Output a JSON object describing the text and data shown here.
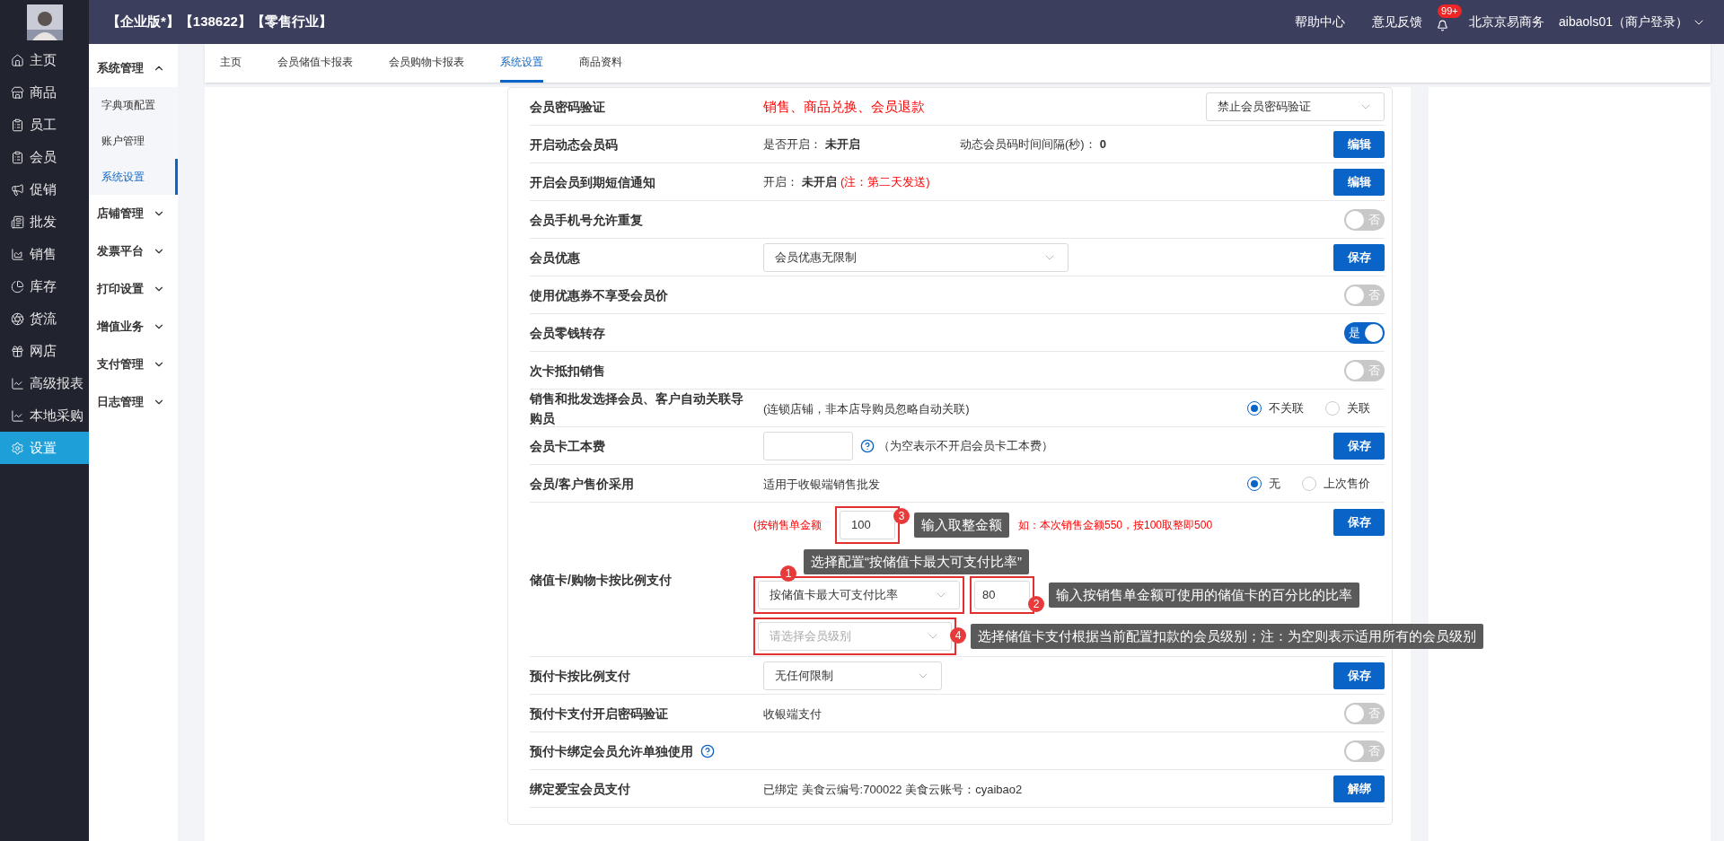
{
  "header": {
    "title": "【企业版*】【138622】【零售行业】",
    "links": [
      "帮助中心",
      "意见反馈"
    ],
    "notification_badge": "99+",
    "company": "北京京易商务",
    "user": "aibaols01（商户登录）"
  },
  "nav": [
    {
      "label": "主页",
      "selected": false
    },
    {
      "label": "商品",
      "selected": false
    },
    {
      "label": "员工",
      "selected": false
    },
    {
      "label": "会员",
      "selected": false
    },
    {
      "label": "促销",
      "selected": false
    },
    {
      "label": "批发",
      "selected": false
    },
    {
      "label": "销售",
      "selected": false
    },
    {
      "label": "库存",
      "selected": false
    },
    {
      "label": "货流",
      "selected": false
    },
    {
      "label": "网店",
      "selected": false
    },
    {
      "label": "高级报表",
      "selected": false
    },
    {
      "label": "本地采购",
      "selected": false
    },
    {
      "label": "设置",
      "selected": true
    }
  ],
  "subnav": [
    {
      "label": "系统管理",
      "expanded": true,
      "children": [
        {
          "label": "字典项配置",
          "selected": false
        },
        {
          "label": "账户管理",
          "selected": false
        },
        {
          "label": "系统设置",
          "selected": true
        }
      ]
    },
    {
      "label": "店铺管理",
      "expanded": false
    },
    {
      "label": "发票平台",
      "expanded": false
    },
    {
      "label": "打印设置",
      "expanded": false
    },
    {
      "label": "增值业务",
      "expanded": false
    },
    {
      "label": "支付管理",
      "expanded": false
    },
    {
      "label": "日志管理",
      "expanded": false
    }
  ],
  "tabs": [
    {
      "label": "主页",
      "selected": false
    },
    {
      "label": "会员储值卡报表",
      "selected": false
    },
    {
      "label": "会员购物卡报表",
      "selected": false
    },
    {
      "label": "系统设置",
      "selected": true
    },
    {
      "label": "商品资料",
      "selected": false
    }
  ],
  "settings": [
    {
      "kind": "select",
      "label": "会员密码验证",
      "note": "销售、商品兑换、会员退款",
      "select": "禁止会员密码验证"
    },
    {
      "kind": "status",
      "label": "开启动态会员码",
      "items": [
        {
          "label": "是否开启：",
          "value": "未开启"
        },
        {
          "label": "动态会员码时间间隔(秒)：",
          "value": "0"
        }
      ],
      "button": "编辑"
    },
    {
      "kind": "status",
      "label": "开启会员到期短信通知",
      "items": [
        {
          "label": "开启：",
          "value": "未开启",
          "remark": "(注：第二天发送)"
        }
      ],
      "button": "编辑"
    },
    {
      "kind": "toggle",
      "label": "会员手机号允许重复",
      "on": false,
      "toggle_text": "否"
    },
    {
      "kind": "select_save",
      "label": "会员优惠",
      "select": "会员优惠无限制",
      "button": "保存"
    },
    {
      "kind": "toggle",
      "label": "使用优惠券不享受会员价",
      "on": false,
      "toggle_text": "否"
    },
    {
      "kind": "toggle",
      "label": "会员零钱转存",
      "on": true,
      "toggle_text": "是"
    },
    {
      "kind": "toggle",
      "label": "次卡抵扣销售",
      "on": false,
      "toggle_text": "否"
    },
    {
      "kind": "radio",
      "label": "销售和批发选择会员、客户自动关联导购员",
      "note": "(连锁店铺，非本店导购员忽略自动关联)",
      "options": [
        {
          "label": "不关联",
          "selected": true
        },
        {
          "label": "关联",
          "selected": false
        }
      ]
    },
    {
      "kind": "input_save",
      "label": "会员卡工本费",
      "note": "（为空表示不开启会员卡工本费）",
      "button": "保存"
    },
    {
      "kind": "radio",
      "label": "会员/客户售价采用",
      "note": "适用于收银端销售批发",
      "options": [
        {
          "label": "无",
          "selected": true
        },
        {
          "label": "上次售价",
          "selected": false
        }
      ]
    },
    {
      "kind": "ratio",
      "label": "储值卡/购物卡按比例支付",
      "prefix": "(按销售单金额",
      "round_value": "100",
      "suffix": "如：本次销售金额550，按100取整即500",
      "ratio_select": "按储值卡最大可支付比率",
      "ratio_value": "80",
      "level_placeholder": "请选择会员级别",
      "button": "保存",
      "annotations": [
        {
          "number": "3",
          "text": "输入取整金额"
        },
        {
          "number": "1",
          "text": "选择配置“按储值卡最大可支付比率”"
        },
        {
          "number": "2",
          "text": "输入按销售单金额可使用的储值卡的百分比的比率"
        },
        {
          "number": "4",
          "text": "选择储值卡支付根据当前配置扣款的会员级别；注：为空则表示适用所有的会员级别"
        }
      ]
    },
    {
      "kind": "select_save",
      "label": "预付卡按比例支付",
      "select": "无任何限制",
      "button": "保存"
    },
    {
      "kind": "toggle",
      "label": "预付卡支付开启密码验证",
      "note": "收银端支付",
      "on": false,
      "toggle_text": "否"
    },
    {
      "kind": "toggle",
      "label": "预付卡绑定会员允许单独使用",
      "help": true,
      "on": false,
      "toggle_text": "否"
    },
    {
      "kind": "text_button",
      "label": "绑定爱宝会员支付",
      "note": "已绑定 美食云编号:700022 美食云账号：cyaibao2",
      "button": "解绑"
    }
  ]
}
